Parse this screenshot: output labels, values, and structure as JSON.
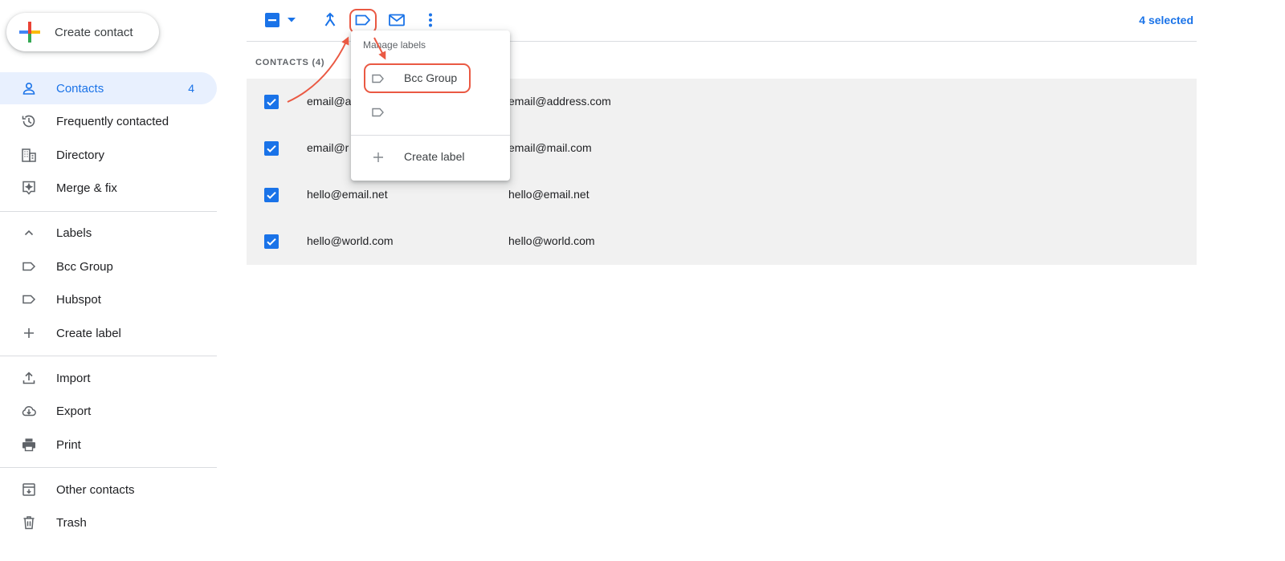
{
  "sidebar": {
    "create_label": "Create label",
    "items": [
      {
        "label": "Contacts",
        "count": "4",
        "icon": "person-icon",
        "active": true
      },
      {
        "label": "Frequently contacted",
        "icon": "history-icon"
      },
      {
        "label": "Directory",
        "icon": "building-icon"
      },
      {
        "label": "Merge & fix",
        "icon": "merge-fix-icon"
      }
    ],
    "labels_header": "Labels",
    "labels": [
      {
        "label": "Bcc Group",
        "icon": "label-icon"
      },
      {
        "label": "Hubspot",
        "icon": "label-icon"
      }
    ],
    "create_contact": "Create contact",
    "actions": [
      {
        "label": "Import",
        "icon": "upload-icon"
      },
      {
        "label": "Export",
        "icon": "cloud-download-icon"
      },
      {
        "label": "Print",
        "icon": "printer-icon"
      }
    ],
    "footer": [
      {
        "label": "Other contacts",
        "icon": "archive-icon"
      },
      {
        "label": "Trash",
        "icon": "trash-icon"
      }
    ]
  },
  "toolbar": {
    "selected_text": "4 selected"
  },
  "contacts": {
    "heading": "CONTACTS (4)",
    "rows": [
      {
        "name": "email@a",
        "email": "email@address.com",
        "checked": true
      },
      {
        "name": "email@r",
        "email": "email@mail.com",
        "checked": true
      },
      {
        "name": "hello@email.net",
        "email": "hello@email.net",
        "checked": true
      },
      {
        "name": "hello@world.com",
        "email": "hello@world.com",
        "checked": true
      }
    ]
  },
  "menu": {
    "title": "Manage labels",
    "items": [
      {
        "label": "Bcc Group",
        "icon": "label-icon"
      },
      {
        "label": "",
        "icon": "label-icon"
      }
    ],
    "create_label": "Create label"
  },
  "colors": {
    "accent": "#1a73e8",
    "highlight": "#ea5943",
    "active_bg": "#e8f0fe"
  }
}
